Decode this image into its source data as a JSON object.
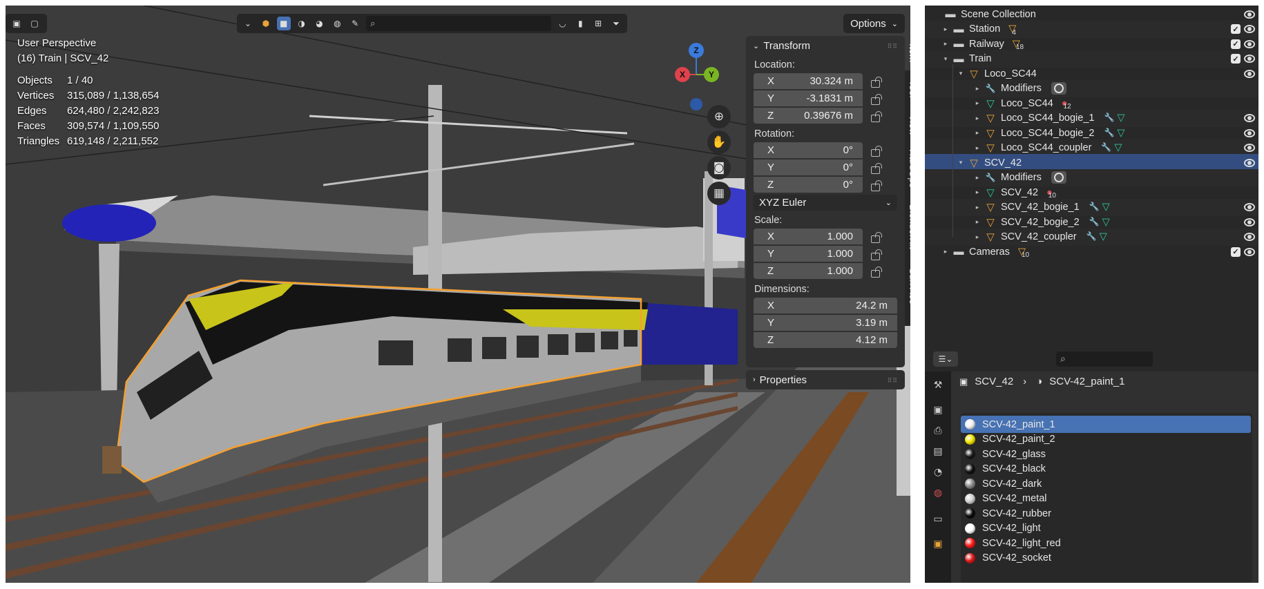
{
  "viewport": {
    "info": {
      "view_name": "User Perspective",
      "object_path": "(16) Train | SCV_42"
    },
    "stats": [
      {
        "label": "Objects",
        "value": "1 / 40"
      },
      {
        "label": "Vertices",
        "value": "315,089 / 1,138,654"
      },
      {
        "label": "Edges",
        "value": "624,480 / 2,242,823"
      },
      {
        "label": "Faces",
        "value": "309,574 / 1,109,550"
      },
      {
        "label": "Triangles",
        "value": "619,148 / 2,211,552"
      }
    ],
    "options_label": "Options",
    "gizmo": {
      "x": "X",
      "y": "Y",
      "z": "Z"
    }
  },
  "transform": {
    "title": "Transform",
    "location_label": "Location:",
    "location": [
      {
        "axis": "X",
        "value": "30.324 m"
      },
      {
        "axis": "Y",
        "value": "-3.1831 m"
      },
      {
        "axis": "Z",
        "value": "0.39676 m"
      }
    ],
    "rotation_label": "Rotation:",
    "rotation": [
      {
        "axis": "X",
        "value": "0°"
      },
      {
        "axis": "Y",
        "value": "0°"
      },
      {
        "axis": "Z",
        "value": "0°"
      }
    ],
    "rotation_mode": "XYZ Euler",
    "scale_label": "Scale:",
    "scale": [
      {
        "axis": "X",
        "value": "1.000"
      },
      {
        "axis": "Y",
        "value": "1.000"
      },
      {
        "axis": "Z",
        "value": "1.000"
      }
    ],
    "dimensions_label": "Dimensions:",
    "dimensions": [
      {
        "axis": "X",
        "value": "24.2 m"
      },
      {
        "axis": "Y",
        "value": "3.19 m"
      },
      {
        "axis": "Z",
        "value": "4.12 m"
      }
    ],
    "properties_title": "Properties"
  },
  "sidebar_tabs": [
    "Item",
    "Tool",
    "View",
    "HardOps",
    "BlenderKit",
    "Surf Ace"
  ],
  "outliner": {
    "rows": [
      {
        "name": "Scene Collection"
      },
      {
        "name": "Station",
        "badge": "4"
      },
      {
        "name": "Railway",
        "badge": "18"
      },
      {
        "name": "Train"
      },
      {
        "name": "Loco_SC44"
      },
      {
        "name": "Modifiers"
      },
      {
        "name": "Loco_SC44",
        "badge": "12"
      },
      {
        "name": "Loco_SC44_bogie_1"
      },
      {
        "name": "Loco_SC44_bogie_2"
      },
      {
        "name": "Loco_SC44_coupler"
      },
      {
        "name": "SCV_42"
      },
      {
        "name": "Modifiers"
      },
      {
        "name": "SCV_42",
        "badge": "10"
      },
      {
        "name": "SCV_42_bogie_1"
      },
      {
        "name": "SCV_42_bogie_2"
      },
      {
        "name": "SCV_42_coupler"
      },
      {
        "name": "Cameras",
        "badge": "10"
      }
    ]
  },
  "properties": {
    "breadcrumb_object": "SCV_42",
    "breadcrumb_material": "SCV-42_paint_1",
    "materials": [
      {
        "name": "SCV-42_paint_1",
        "color": "#f0f0f0"
      },
      {
        "name": "SCV-42_paint_2",
        "color": "#f2e600"
      },
      {
        "name": "SCV-42_glass",
        "color": "#1a1a1a"
      },
      {
        "name": "SCV-42_black",
        "color": "#111111"
      },
      {
        "name": "SCV-42_dark",
        "color": "#8a8a8a"
      },
      {
        "name": "SCV-42_metal",
        "color": "#d0d0d0"
      },
      {
        "name": "SCV-42_rubber",
        "color": "#0c0c0c"
      },
      {
        "name": "SCV-42_light",
        "color": "#ffffff"
      },
      {
        "name": "SCV-42_light_red",
        "color": "#ff1a1a"
      },
      {
        "name": "SCV-42_socket",
        "color": "#e01818"
      }
    ]
  }
}
